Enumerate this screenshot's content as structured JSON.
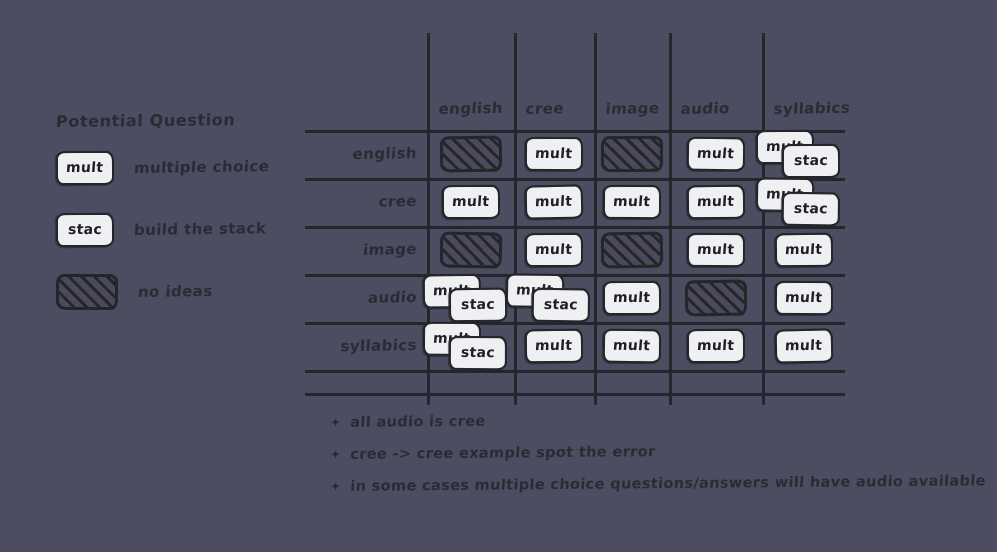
{
  "canvas": {
    "background_color": "#4d4d61",
    "ink_color": "#2b2b33",
    "card_fill_color": "#eef0f2"
  },
  "legend": {
    "title": "Potential Question",
    "items": [
      {
        "chip_label": "mult",
        "chip_kind": "card",
        "label": "multiple choice"
      },
      {
        "chip_label": "stac",
        "chip_kind": "card",
        "label": "build the stack"
      },
      {
        "chip_label": "",
        "chip_kind": "hatch",
        "label": "no ideas"
      }
    ]
  },
  "matrix": {
    "columns": [
      "english",
      "cree",
      "image",
      "audio",
      "syllabics"
    ],
    "rows": [
      "english",
      "cree",
      "image",
      "audio",
      "syllabics"
    ],
    "cells": [
      [
        {
          "kind": "hatch",
          "label": ""
        },
        {
          "kind": "card",
          "label": "mult"
        },
        {
          "kind": "hatch",
          "label": ""
        },
        {
          "kind": "card",
          "label": "mult"
        },
        {
          "kind": "stack",
          "back_label": "mult",
          "front_label": "stac"
        }
      ],
      [
        {
          "kind": "card",
          "label": "mult"
        },
        {
          "kind": "card",
          "label": "mult"
        },
        {
          "kind": "card",
          "label": "mult"
        },
        {
          "kind": "card",
          "label": "mult"
        },
        {
          "kind": "stack",
          "back_label": "mult",
          "front_label": "stac"
        }
      ],
      [
        {
          "kind": "hatch",
          "label": ""
        },
        {
          "kind": "card",
          "label": "mult"
        },
        {
          "kind": "hatch",
          "label": ""
        },
        {
          "kind": "card",
          "label": "mult"
        },
        {
          "kind": "card",
          "label": "mult"
        }
      ],
      [
        {
          "kind": "stack",
          "back_label": "mult",
          "front_label": "stac"
        },
        {
          "kind": "stack",
          "back_label": "mult",
          "front_label": "stac"
        },
        {
          "kind": "card",
          "label": "mult"
        },
        {
          "kind": "hatch",
          "label": ""
        },
        {
          "kind": "card",
          "label": "mult"
        }
      ],
      [
        {
          "kind": "stack",
          "back_label": "mult",
          "front_label": "stac"
        },
        {
          "kind": "card",
          "label": "mult"
        },
        {
          "kind": "card",
          "label": "mult"
        },
        {
          "kind": "card",
          "label": "mult"
        },
        {
          "kind": "card",
          "label": "mult"
        }
      ]
    ]
  },
  "notes": {
    "bullet_glyph": "✦",
    "items": [
      "all audio is cree",
      "cree -> cree example spot the error",
      "in some cases multiple choice questions/answers will have audio available"
    ]
  }
}
